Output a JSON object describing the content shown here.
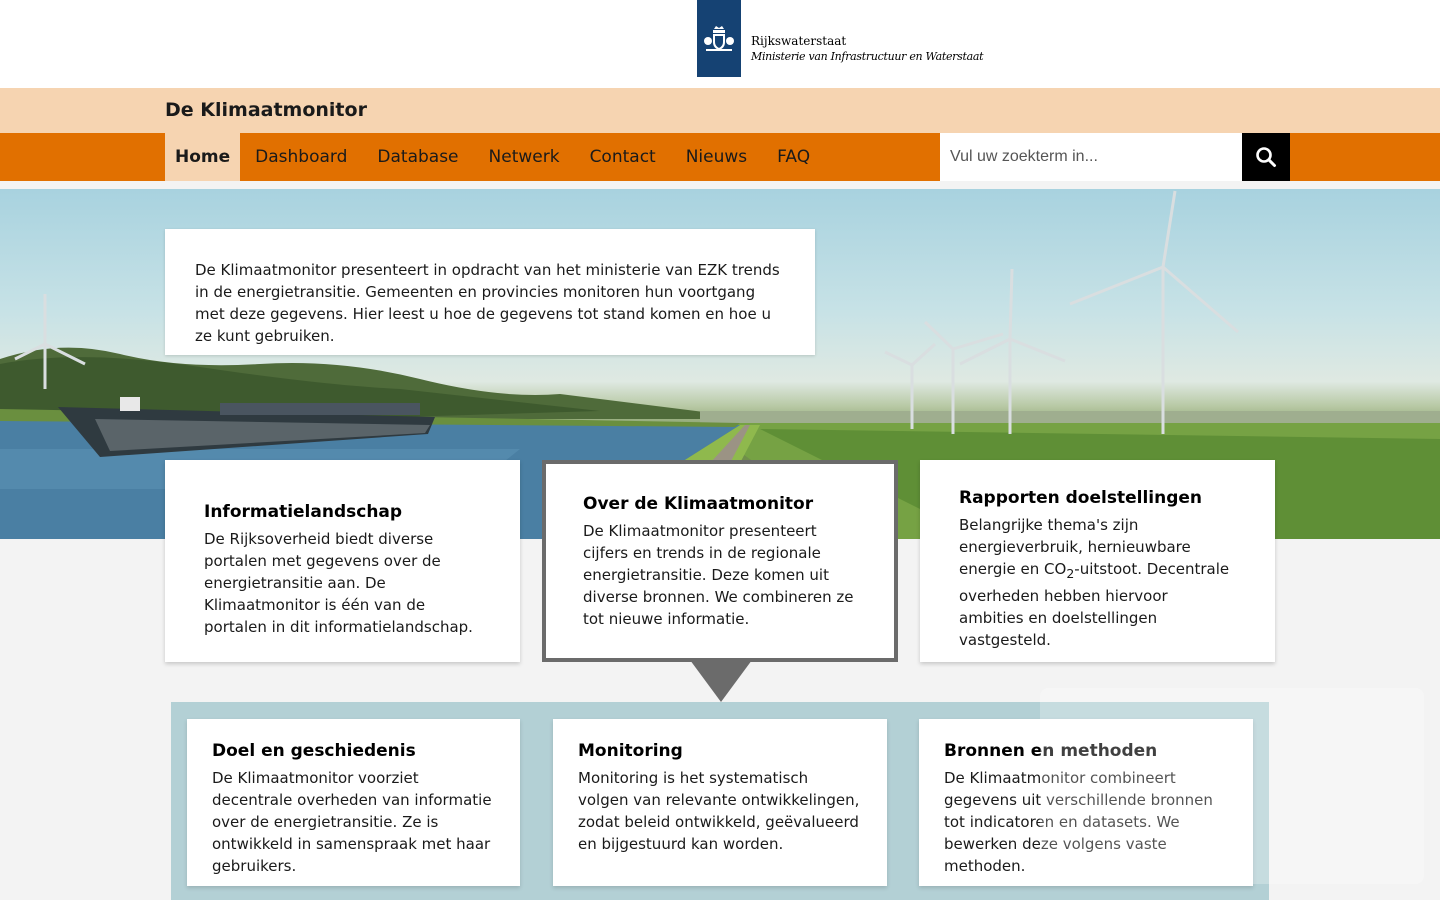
{
  "header": {
    "org_name": "Rijkswaterstaat",
    "ministry": "Ministerie van Infrastructuur en Waterstaat",
    "site_title": "De Klimaatmonitor",
    "brand_color": "#154273",
    "accent_color": "#e17000"
  },
  "nav": {
    "items": [
      {
        "label": "Home",
        "active": true
      },
      {
        "label": "Dashboard"
      },
      {
        "label": "Database"
      },
      {
        "label": "Netwerk"
      },
      {
        "label": "Contact"
      },
      {
        "label": "Nieuws"
      },
      {
        "label": "FAQ"
      }
    ],
    "search_placeholder": "Vul uw zoekterm in...",
    "search_icon": "search-icon"
  },
  "intro": {
    "text": "De Klimaatmonitor presenteert in opdracht van het ministerie van EZK trends in de energietransitie. Gemeenten en provincies monitoren hun voortgang met deze gegevens. Hier leest u hoe de gegevens tot stand komen en hoe u ze kunt gebruiken."
  },
  "cards": [
    {
      "title": "Informatielandschap",
      "text": "De Rijksoverheid biedt diverse portalen met gegevens over de energietransitie aan. De Klimaatmonitor is één van de portalen in dit informatielandschap."
    },
    {
      "title": "Over de Klimaatmonitor",
      "text": "De Klimaatmonitor presenteert cijfers en trends in de regionale energietransitie. Deze komen uit diverse bronnen. We combineren ze tot nieuwe informatie."
    },
    {
      "title": "Rapporten doelstellingen",
      "text_before": "Belangrijke thema's zijn energieverbruik, hernieuwbare energie en CO",
      "subscript": "2",
      "text_after": "-uitstoot. Decentrale overheden hebben hiervoor ambities en doelstellingen vastgesteld."
    }
  ],
  "subcards": [
    {
      "title": "Doel en geschiedenis",
      "text": "De Klimaatmonitor voorziet decentrale overheden van informatie over de energietransitie. Ze is ontwikkeld in samenspraak met haar gebruikers."
    },
    {
      "title": "Monitoring",
      "text": "Monitoring is het systematisch volgen van relevante ontwikkelingen, zodat beleid ontwikkeld, geëvalueerd en bijgestuurd kan worden."
    },
    {
      "title": "Bronnen en methoden",
      "text": "De Klimaatmonitor combineert gegevens uit verschillende bronnen tot indicatoren en datasets. We bewerken deze volgens vaste methoden."
    }
  ]
}
